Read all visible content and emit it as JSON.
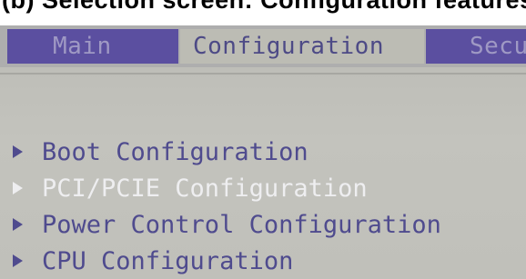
{
  "caption": "(b) Selection screen: Configuration features",
  "tabs": [
    {
      "label": "Main",
      "active": false
    },
    {
      "label": "Configuration",
      "active": true
    },
    {
      "label": "Security",
      "active": false
    }
  ],
  "menu_items": [
    {
      "label": "Boot Configuration",
      "selected": false
    },
    {
      "label": "PCI/PCIE Configuration",
      "selected": true
    },
    {
      "label": "Power Control Configuration",
      "selected": false
    },
    {
      "label": "CPU Configuration",
      "selected": false
    }
  ],
  "icons": {
    "submenu_arrow": "right-triangle"
  },
  "colors": {
    "tab_inactive_bg": "#5b4fa0",
    "tab_inactive_text": "#9f99c4",
    "tab_active_text": "#4d4a86",
    "menu_text": "#4f4b8e",
    "menu_selected_text": "#eeeef0",
    "screen_bg": "#bdbdb6"
  }
}
